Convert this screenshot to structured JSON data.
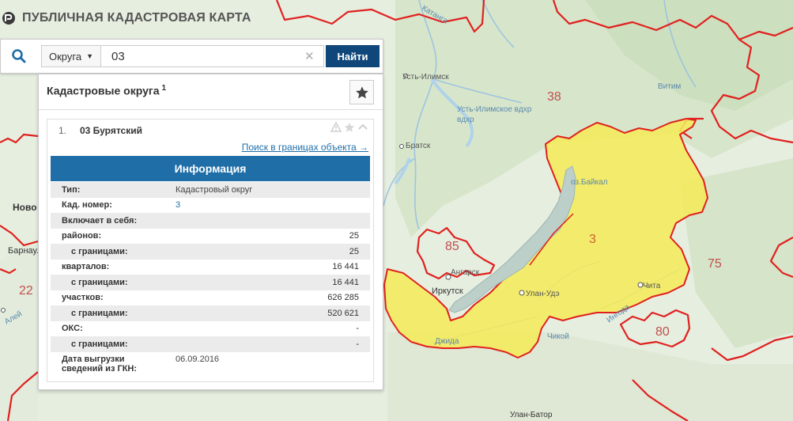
{
  "app": {
    "title": "ПУБЛИЧНАЯ КАДАСТРОВАЯ КАРТА"
  },
  "search": {
    "type_label": "Округа",
    "value": "03",
    "button": "Найти"
  },
  "panel": {
    "title": "Кадастровые округа",
    "count": "1"
  },
  "result": {
    "index": "1.",
    "name": "03 Бурятский",
    "search_link": "Поиск в границах объекта →",
    "info_header": "Информация",
    "rows": [
      {
        "label": "Тип:",
        "value": "Кадастровый округ"
      },
      {
        "label": "Кад. номер:",
        "value": "3"
      },
      {
        "label": "Включает в себя:",
        "value": ""
      },
      {
        "label": "районов:",
        "value": "25"
      },
      {
        "label": "с границами:",
        "value": "25"
      },
      {
        "label": "кварталов:",
        "value": "16 441"
      },
      {
        "label": "с границами:",
        "value": "16 441"
      },
      {
        "label": "участков:",
        "value": "626 285"
      },
      {
        "label": "с границами:",
        "value": "520 621"
      },
      {
        "label": "ОКС:",
        "value": "-"
      },
      {
        "label": "с границами:",
        "value": "-"
      },
      {
        "label": "Дата выгрузки сведений из ГКН:",
        "value": "06.09.2016"
      }
    ]
  },
  "map": {
    "region_numbers": [
      "38",
      "3",
      "85",
      "75",
      "80",
      "22"
    ],
    "places": [
      "Усть-Илимск",
      "Усть-Илимское вдхр",
      "Братск",
      "оз.Байкал",
      "Ангарск",
      "Иркутск",
      "Улан-Удэ",
      "Чита",
      "Витим",
      "Ингода",
      "Джида",
      "Чикой",
      "Улан-Батор",
      "Катанга",
      "Барнаул",
      "Ново",
      "Алей"
    ]
  },
  "colors": {
    "accent": "#10477a",
    "info_blue": "#1f6ea8",
    "border_red": "#e0211f",
    "selected_fill": "#f5ea5a"
  },
  "icons": [
    "search-icon",
    "caret-down-icon",
    "close-icon",
    "star-icon",
    "warning-icon",
    "chevron-up-icon"
  ]
}
